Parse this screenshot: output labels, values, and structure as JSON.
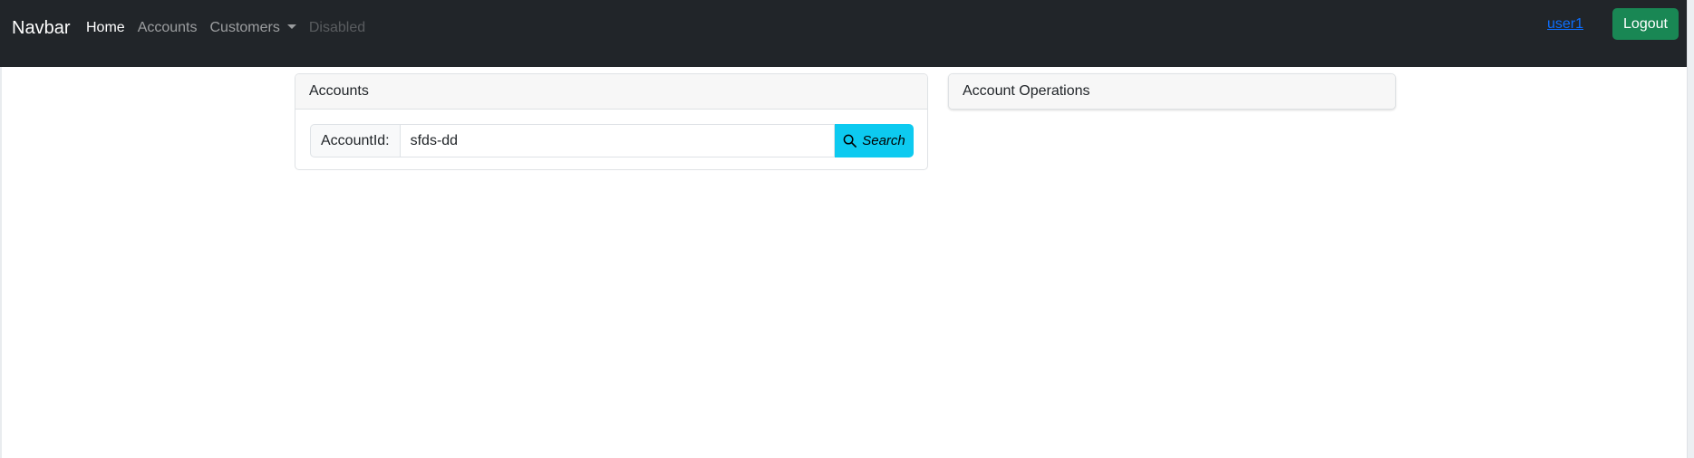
{
  "navbar": {
    "brand": "Navbar",
    "links": [
      {
        "label": "Home",
        "state": "active"
      },
      {
        "label": "Accounts",
        "state": "normal"
      },
      {
        "label": "Customers",
        "state": "dropdown"
      },
      {
        "label": "Disabled",
        "state": "disabled"
      }
    ],
    "user_label": "user1",
    "logout_label": "Logout"
  },
  "accounts_card": {
    "title": "Accounts",
    "field_label": "AccountId:",
    "field_value": "sfds-dd",
    "search_label": "Search",
    "search_icon": "search-icon"
  },
  "operations_card": {
    "title": "Account Operations"
  },
  "colors": {
    "navbar_bg": "#212529",
    "logout_bg": "#198754",
    "search_bg": "#0dcaf0",
    "link": "#0d6efd"
  }
}
